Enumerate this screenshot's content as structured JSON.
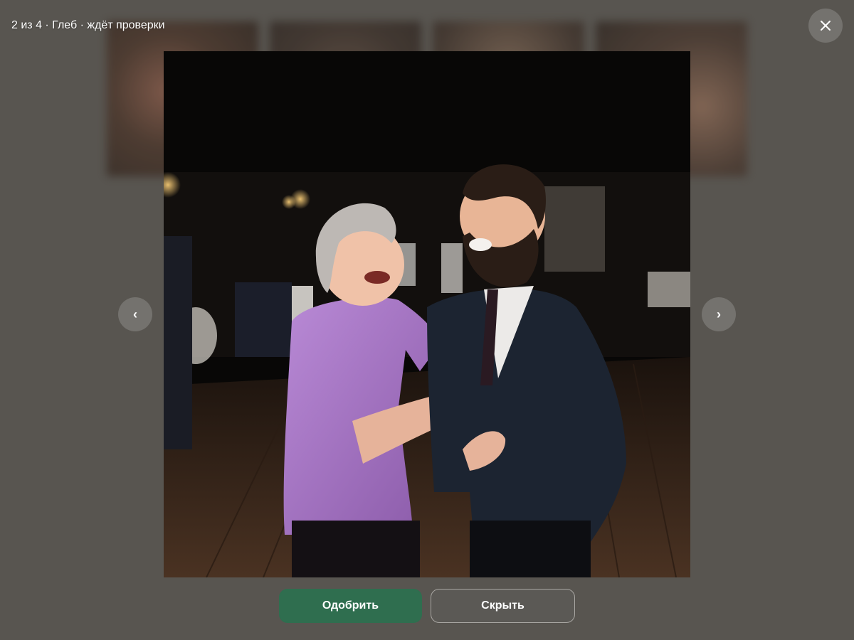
{
  "viewer": {
    "counter_text": "2 из 4 · Глеб · ждёт проверки",
    "prev_glyph": "‹",
    "next_glyph": "›",
    "close_icon": "close-icon",
    "photo_description_icon": "photo"
  },
  "actions": {
    "approve_label": "Одобрить",
    "hide_label": "Скрыть"
  },
  "colors": {
    "overlay_background": "#585550",
    "approve_button": "#2f6e4f",
    "hide_button": "#5b5955",
    "control_circle": "#8c8a86"
  }
}
